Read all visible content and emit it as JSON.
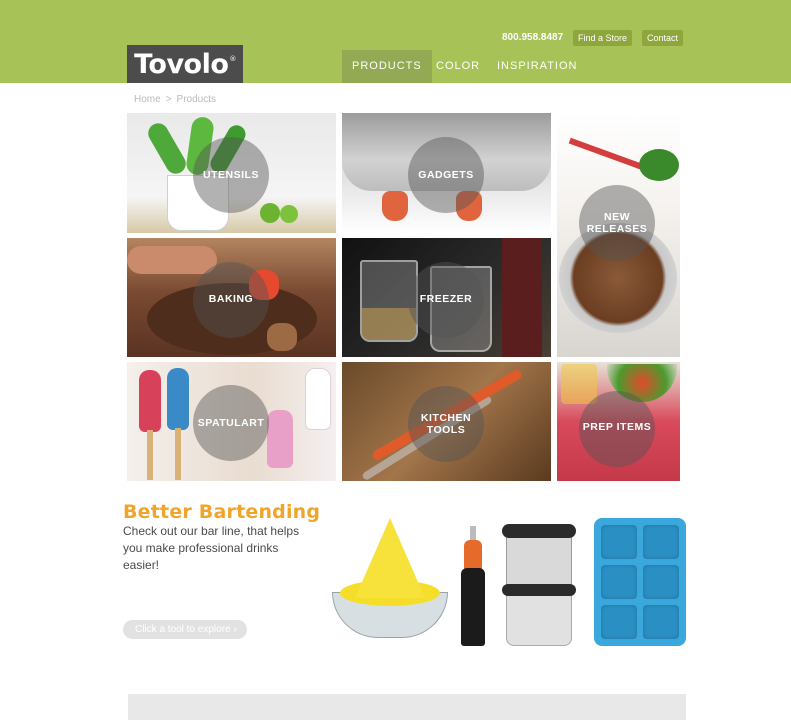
{
  "header": {
    "brand": "Tovolo",
    "brand_mark": "®",
    "phone": "800.958.8487",
    "find_store": "Find a Store",
    "contact": "Contact",
    "nav": [
      {
        "label": "PRODUCTS",
        "active": true
      },
      {
        "label": "COLOR",
        "active": false
      },
      {
        "label": "INSPIRATION",
        "active": false
      }
    ],
    "bg_color": "#a7c257"
  },
  "breadcrumb": {
    "home": "Home",
    "separator": ">",
    "current": "Products"
  },
  "categories": [
    {
      "label": "UTENSILS"
    },
    {
      "label": "GADGETS"
    },
    {
      "label": "NEW",
      "label2": "RELEASES"
    },
    {
      "label": "BAKING"
    },
    {
      "label": "FREEZER"
    },
    {
      "label": "SPATULART"
    },
    {
      "label": "KITCHEN",
      "label2": "TOOLS"
    },
    {
      "label": "PREP ITEMS"
    }
  ],
  "bartending": {
    "title": "Better Bartending",
    "text": "Check out our bar line, that helps you make professional drinks easier!",
    "explore_label": "Click a tool to explore",
    "explore_chevron": "›",
    "title_color": "#f0a52a"
  },
  "products": [
    {
      "name": "juicer",
      "icon": "citrus-juicer-icon"
    },
    {
      "name": "pourer",
      "icon": "bottle-pourer-icon"
    },
    {
      "name": "ice-molds",
      "icon": "sphere-ice-mold-icon"
    },
    {
      "name": "ice-tray",
      "icon": "king-cube-tray-icon"
    }
  ]
}
